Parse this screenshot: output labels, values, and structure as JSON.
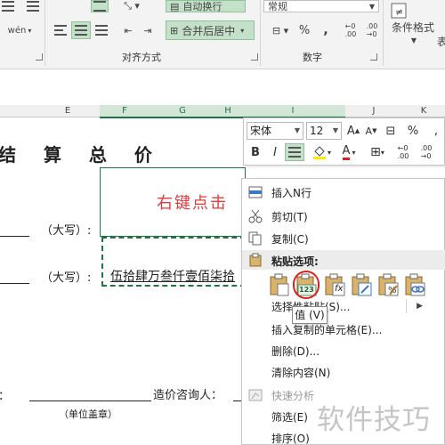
{
  "ribbon": {
    "wen": "wén",
    "wrap_text": "自动换行",
    "merge_center": "合并后居中",
    "number_format": "常规",
    "percent": "%",
    "comma": ",",
    "conditional_format": "条件格式",
    "table_prefix": "表",
    "group_alignment": "对齐方式",
    "group_number": "数字"
  },
  "columns": [
    {
      "letter": "E"
    },
    {
      "letter": "F"
    },
    {
      "letter": "G"
    },
    {
      "letter": "H"
    },
    {
      "letter": "I"
    },
    {
      "letter": "J"
    },
    {
      "letter": "K"
    }
  ],
  "sheet": {
    "title": "结 算 总 价",
    "daxie_1": "（大写）:",
    "daxie_2": "（大写）:",
    "red_hint": "右键点击",
    "amount": "伍拾肆万叁仟壹佰柒拾",
    "colon_left": "：",
    "consultant_label": "造价咨询人：",
    "seal_note": "（单位盖章）"
  },
  "mini_toolbar": {
    "font_name": "宋体",
    "font_size": "12",
    "font_grow": "A",
    "font_shrink": "A",
    "percent": "%",
    "bold": "B",
    "italic": "I",
    "font_color_letter": "A"
  },
  "context_menu": {
    "insert_row": "插入N行",
    "cut": "剪切(T)",
    "copy": "复制(C)",
    "paste_options": "粘贴选项:",
    "paste_special": "选择性粘贴(S)...",
    "insert_copied": "插入复制的单元格(E)...",
    "delete": "删除(D)...",
    "clear": "清除内容(N)",
    "quick_analysis": "快速分析",
    "filter": "筛选(E)",
    "sort": "排序(O)",
    "paste_value_badge": "123",
    "paste_formula_badge": "fx"
  },
  "tooltip": {
    "text": "值 (V)"
  },
  "watermark": {
    "text": "软件技巧"
  },
  "colors": {
    "excel_green": "#217346",
    "highlight": "#c5e0c9",
    "red_text": "#e23b3b",
    "selection_ring": "#e02020"
  }
}
